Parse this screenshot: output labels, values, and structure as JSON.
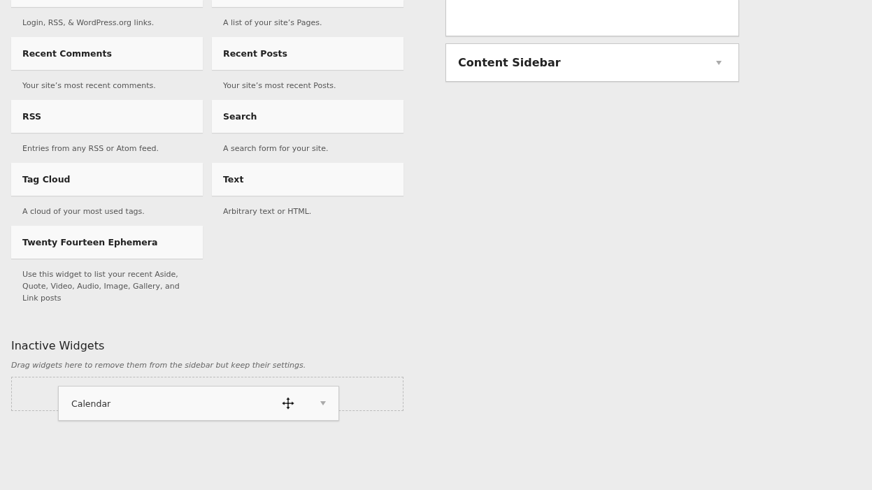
{
  "available_widgets": [
    {
      "description": "Login, RSS, & WordPress.org links."
    },
    {
      "description": "A list of your site’s Pages."
    },
    {
      "title": "Recent Comments",
      "description": "Your site’s most recent comments."
    },
    {
      "title": "Recent Posts",
      "description": "Your site’s most recent Posts."
    },
    {
      "title": "RSS",
      "description": "Entries from any RSS or Atom feed."
    },
    {
      "title": "Search",
      "description": "A search form for your site."
    },
    {
      "title": "Tag Cloud",
      "description": "A cloud of your most used tags."
    },
    {
      "title": "Text",
      "description": "Arbitrary text or HTML."
    },
    {
      "title": "Twenty Fourteen Ephemera",
      "description": "Use this widget to list your recent Aside, Quote, Video, Audio, Image, Gallery, and Link posts"
    }
  ],
  "inactive_widgets": {
    "heading": "Inactive Widgets",
    "hint": "Drag widgets here to remove them from the sidebar but keep their settings.",
    "dragged_widget": {
      "title": "Calendar"
    }
  },
  "sidebars": [
    {
      "expanded": true
    },
    {
      "title": "Content Sidebar",
      "expanded": false
    }
  ]
}
